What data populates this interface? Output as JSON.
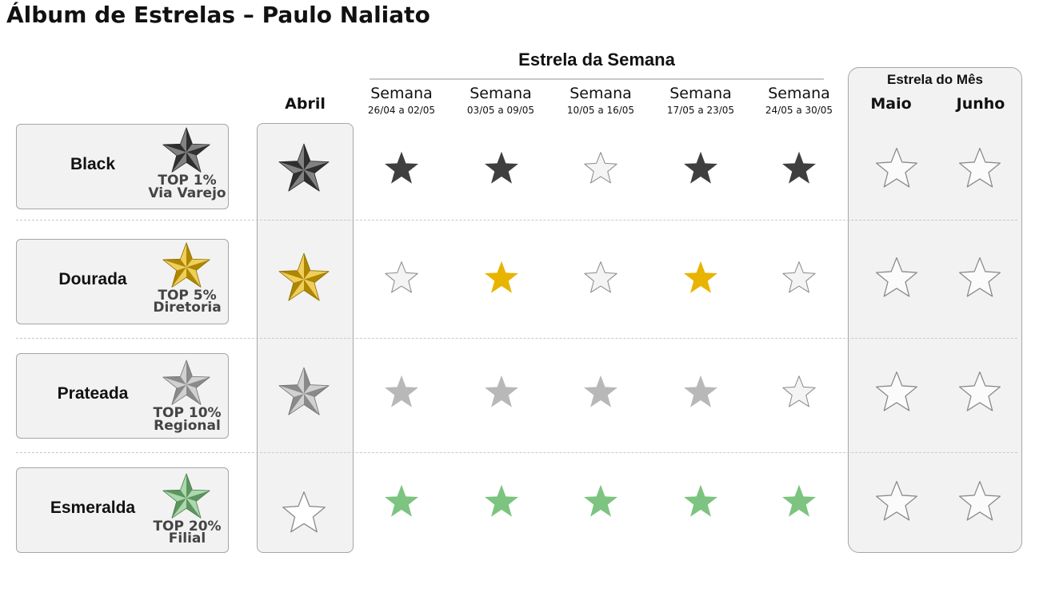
{
  "title": "Álbum de Estrelas – Paulo Naliato",
  "weekly_section": {
    "title": "Estrela da Semana",
    "weeks": [
      {
        "label": "Semana",
        "dates": "26/04 a 02/05"
      },
      {
        "label": "Semana",
        "dates": "03/05 a 09/05"
      },
      {
        "label": "Semana",
        "dates": "10/05 a 16/05"
      },
      {
        "label": "Semana",
        "dates": "17/05 a 23/05"
      },
      {
        "label": "Semana",
        "dates": "24/05 a 30/05"
      }
    ]
  },
  "april_column": {
    "label": "Abril"
  },
  "monthly_section": {
    "title": "Estrela do Mês",
    "months": [
      {
        "label": "Maio"
      },
      {
        "label": "Junho"
      }
    ]
  },
  "colors": {
    "black": "#3f3f3f",
    "gold": "#e8b400",
    "silver": "#b8b8b8",
    "emerald": "#7cc47f",
    "empty_fill": "#f4f4f4",
    "empty_stroke": "#8a8a8a",
    "panel": "#f2f2f2"
  },
  "tiers": [
    {
      "name": "Black",
      "badge_color": "black",
      "top": "TOP  1%",
      "scope": "Via Varejo",
      "april": "earned",
      "weeks": [
        "earned",
        "earned",
        "empty",
        "earned",
        "earned"
      ],
      "months": [
        "empty",
        "empty"
      ]
    },
    {
      "name": "Dourada",
      "badge_color": "gold",
      "top": "TOP  5%",
      "scope": "Diretoria",
      "april": "earned",
      "weeks": [
        "empty",
        "earned",
        "empty",
        "earned",
        "empty"
      ],
      "months": [
        "empty",
        "empty"
      ]
    },
    {
      "name": "Prateada",
      "badge_color": "silver",
      "top": "TOP  10%",
      "scope": "Regional",
      "april": "earned",
      "weeks": [
        "earned",
        "earned",
        "earned",
        "earned",
        "empty"
      ],
      "months": [
        "empty",
        "empty"
      ]
    },
    {
      "name": "Esmeralda",
      "badge_color": "emerald",
      "top": "TOP  20%",
      "scope": "Filial",
      "april": "empty",
      "weeks": [
        "earned",
        "earned",
        "earned",
        "earned",
        "earned"
      ],
      "months": [
        "empty",
        "empty"
      ]
    }
  ]
}
